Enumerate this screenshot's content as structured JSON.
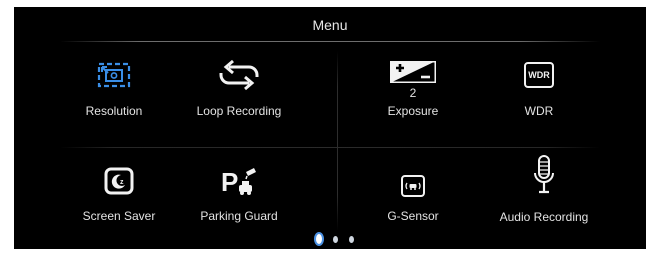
{
  "menu": {
    "title": "Menu"
  },
  "items": [
    {
      "label": "Resolution",
      "icon": "resolution-icon",
      "selected": true
    },
    {
      "label": "Loop  Recording",
      "icon": "loop-recording-icon"
    },
    {
      "label": "Exposure",
      "icon": "exposure-icon",
      "value": "2"
    },
    {
      "label": "WDR",
      "icon": "wdr-icon",
      "badge": "WDR"
    },
    {
      "label": "Screen  Saver",
      "icon": "screen-saver-icon"
    },
    {
      "label": "Parking  Guard",
      "icon": "parking-guard-icon"
    },
    {
      "label": "G-Sensor",
      "icon": "g-sensor-icon"
    },
    {
      "label": "Audio  Recording",
      "icon": "microphone-icon"
    }
  ],
  "pagination": {
    "pages": 3,
    "current": 1
  },
  "colors": {
    "background": "#000000",
    "selected_accent": "#3a8ee6",
    "text": "#e3e3e3"
  }
}
